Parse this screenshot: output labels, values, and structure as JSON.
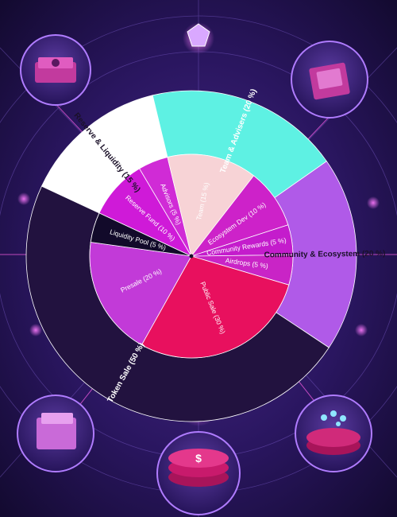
{
  "chart_data": {
    "type": "pie",
    "subtype": "sunburst",
    "outer_ring": [
      {
        "label": "Reserve & Liquidity (15 %)",
        "value": 15,
        "color": "#ffffff",
        "text_color": "#1a1028"
      },
      {
        "label": "Team & Advisers (20 %)",
        "value": 20,
        "color": "#5ef1e3",
        "text_color": "#ffffff"
      },
      {
        "label": "Community & Ecosystem (20 %)",
        "value": 20,
        "color": "#b05ae8",
        "text_color": "#1a1028"
      },
      {
        "label": "Token Sale (50 %)",
        "value": 50,
        "color": "#22123f",
        "text_color": "#ffffff"
      }
    ],
    "inner_ring": [
      {
        "label": "Reserve Fund (10 %)",
        "value": 10,
        "color": "#cf1ad8",
        "text_color": "#ffffff"
      },
      {
        "label": "Advisors (5 %)",
        "value": 5,
        "color": "#d02bd6",
        "text_color": "#ffffff"
      },
      {
        "label": "Team (15 %)",
        "value": 15,
        "color": "#f7d3d6",
        "text_color": "#ffffff"
      },
      {
        "label": "Ecosystem Dev (10 %)",
        "value": 10,
        "color": "#cd22c9",
        "text_color": "#ffffff"
      },
      {
        "label": "Community Rewards (5 %)",
        "value": 5,
        "color": "#c41ccc",
        "text_color": "#ffffff"
      },
      {
        "label": "Airdrops (5 %)",
        "value": 5,
        "color": "#c924c6",
        "text_color": "#ffffff"
      },
      {
        "label": "Public Sale (30 %)",
        "value": 30,
        "color": "#e8105e",
        "text_color": "#ffffff"
      },
      {
        "label": "Presale (20 %)",
        "value": 20,
        "color": "#c23ad8",
        "text_color": "#ffffff"
      },
      {
        "label": "Liquidity Pool (5 %)",
        "value": 5,
        "color": "#120a2a",
        "text_color": "#ffffff"
      }
    ]
  },
  "icons": [
    "money-stack-icon",
    "cash-box-icon",
    "coin-stack-icon",
    "wallet-icon",
    "token-coin-icon",
    "tokens-icon",
    "spider-gem-icon"
  ]
}
